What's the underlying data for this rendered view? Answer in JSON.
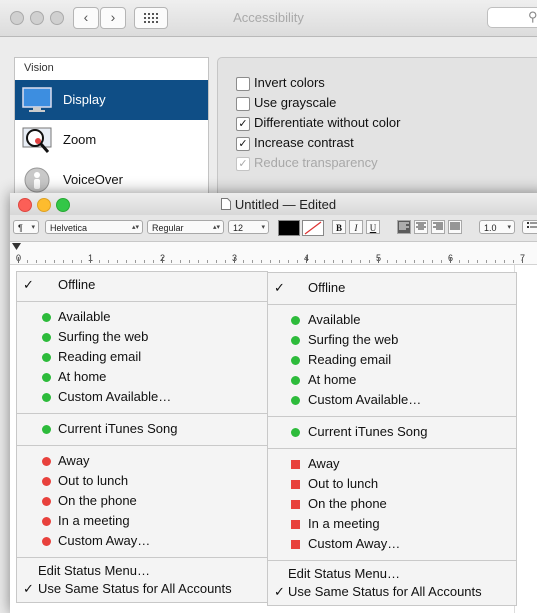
{
  "accessibility_window": {
    "title": "Accessibility",
    "sidebar_header": "Vision",
    "sidebar_items": [
      {
        "label": "Display",
        "icon": "display-icon",
        "selected": true
      },
      {
        "label": "Zoom",
        "icon": "zoom-icon",
        "selected": false
      },
      {
        "label": "VoiceOver",
        "icon": "voiceover-icon",
        "selected": false
      }
    ],
    "options": [
      {
        "label": "Invert colors",
        "checked": false,
        "enabled": true
      },
      {
        "label": "Use grayscale",
        "checked": false,
        "enabled": true
      },
      {
        "label": "Differentiate without color",
        "checked": true,
        "enabled": true
      },
      {
        "label": "Increase contrast",
        "checked": true,
        "enabled": true
      },
      {
        "label": "Reduce transparency",
        "checked": true,
        "enabled": false
      }
    ]
  },
  "textedit": {
    "title": "Untitled",
    "title_suffix": "Edited",
    "title_separator": "—",
    "paragraph_symbol": "¶",
    "font_family": "Helvetica",
    "font_style": "Regular",
    "font_size": "12",
    "bold_label": "B",
    "italic_label": "I",
    "underline_label": "U",
    "line_spacing": "1.0",
    "ruler_numbers": [
      "0",
      "1",
      "2",
      "3",
      "4",
      "5",
      "6",
      "7"
    ]
  },
  "menu_left": {
    "offline": {
      "label": "Offline",
      "checked": true
    },
    "available_group": [
      "Available",
      "Surfing the web",
      "Reading email",
      "At home",
      "Custom Available…"
    ],
    "itunes": "Current iTunes Song",
    "away_group": [
      "Away",
      "Out to lunch",
      "On the phone",
      "In a meeting",
      "Custom Away…"
    ],
    "edit": "Edit Status Menu…",
    "same_status": {
      "label": "Use Same Status for All Accounts",
      "checked": true
    },
    "available_color": "#2dbb3b",
    "away_color": "#e8413c",
    "away_shape": "circle"
  },
  "menu_right": {
    "offline": {
      "label": "Offline",
      "checked": true
    },
    "available_group": [
      "Available",
      "Surfing the web",
      "Reading email",
      "At home",
      "Custom Available…"
    ],
    "itunes": "Current iTunes Song",
    "away_group": [
      "Away",
      "Out to lunch",
      "On the phone",
      "In a meeting",
      "Custom Away…"
    ],
    "edit": "Edit Status Menu…",
    "same_status": {
      "label": "Use Same Status for All Accounts",
      "checked": true
    },
    "available_color": "#2dbb3b",
    "away_color": "#e8413c",
    "away_shape": "square"
  }
}
